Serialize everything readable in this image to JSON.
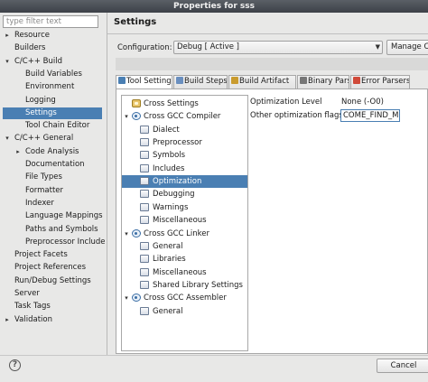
{
  "window": {
    "title": "Properties for sss"
  },
  "filter": {
    "placeholder": "type filter text"
  },
  "left_tree": {
    "items": [
      {
        "label": "Resource",
        "arrow": "▸"
      },
      {
        "label": "Builders",
        "arrow": ""
      },
      {
        "label": "C/C++ Build",
        "arrow": "▾"
      },
      {
        "label": "Build Variables",
        "arrow": ""
      },
      {
        "label": "Environment",
        "arrow": ""
      },
      {
        "label": "Logging",
        "arrow": ""
      },
      {
        "label": "Settings",
        "arrow": "",
        "selected": true
      },
      {
        "label": "Tool Chain Editor",
        "arrow": ""
      },
      {
        "label": "C/C++ General",
        "arrow": "▾"
      },
      {
        "label": "Code Analysis",
        "arrow": "▸"
      },
      {
        "label": "Documentation",
        "arrow": ""
      },
      {
        "label": "File Types",
        "arrow": ""
      },
      {
        "label": "Formatter",
        "arrow": ""
      },
      {
        "label": "Indexer",
        "arrow": ""
      },
      {
        "label": "Language Mappings",
        "arrow": ""
      },
      {
        "label": "Paths and Symbols",
        "arrow": ""
      },
      {
        "label": "Preprocessor Include",
        "arrow": ""
      },
      {
        "label": "Project Facets",
        "arrow": ""
      },
      {
        "label": "Project References",
        "arrow": ""
      },
      {
        "label": "Run/Debug Settings",
        "arrow": ""
      },
      {
        "label": "Server",
        "arrow": ""
      },
      {
        "label": "Task Tags",
        "arrow": ""
      },
      {
        "label": "Validation",
        "arrow": "▸"
      }
    ]
  },
  "page": {
    "title": "Settings"
  },
  "configuration": {
    "label": "Configuration:",
    "value": "Debug  [ Active ]",
    "manage_label": "Manage Co"
  },
  "tabs": [
    {
      "label": "Tool Settings",
      "active": true,
      "icon": "tool-settings-icon"
    },
    {
      "label": "Build Steps",
      "icon": "build-steps-icon"
    },
    {
      "label": "Build Artifact",
      "icon": "build-artifact-icon"
    },
    {
      "label": "Binary Parsers",
      "icon": "binary-parsers-icon"
    },
    {
      "label": "Error Parsers",
      "icon": "error-parsers-icon"
    }
  ],
  "tool_tree": {
    "items": [
      {
        "label": "Cross Settings",
        "icon": "gear",
        "arrow": ""
      },
      {
        "label": "Cross GCC Compiler",
        "icon": "circle",
        "arrow": "▾"
      },
      {
        "label": "Dialect",
        "icon": "folder",
        "arrow": ""
      },
      {
        "label": "Preprocessor",
        "icon": "folder",
        "arrow": ""
      },
      {
        "label": "Symbols",
        "icon": "folder",
        "arrow": ""
      },
      {
        "label": "Includes",
        "icon": "folder",
        "arrow": ""
      },
      {
        "label": "Optimization",
        "icon": "folder",
        "arrow": "",
        "selected": true
      },
      {
        "label": "Debugging",
        "icon": "folder",
        "arrow": ""
      },
      {
        "label": "Warnings",
        "icon": "folder",
        "arrow": ""
      },
      {
        "label": "Miscellaneous",
        "icon": "folder",
        "arrow": ""
      },
      {
        "label": "Cross GCC Linker",
        "icon": "circle",
        "arrow": "▾"
      },
      {
        "label": "General",
        "icon": "folder",
        "arrow": ""
      },
      {
        "label": "Libraries",
        "icon": "folder",
        "arrow": ""
      },
      {
        "label": "Miscellaneous",
        "icon": "folder",
        "arrow": ""
      },
      {
        "label": "Shared Library Settings",
        "icon": "folder",
        "arrow": ""
      },
      {
        "label": "Cross GCC Assembler",
        "icon": "circle",
        "arrow": "▾"
      },
      {
        "label": "General",
        "icon": "folder",
        "arrow": ""
      }
    ]
  },
  "options": {
    "optimization_level_label": "Optimization Level",
    "optimization_level_value": "None (-O0)",
    "other_flags_label": "Other optimization flags",
    "other_flags_value": "COME_FIND_ME"
  },
  "footer": {
    "cancel_label": "Cancel",
    "help_glyph": "?"
  }
}
